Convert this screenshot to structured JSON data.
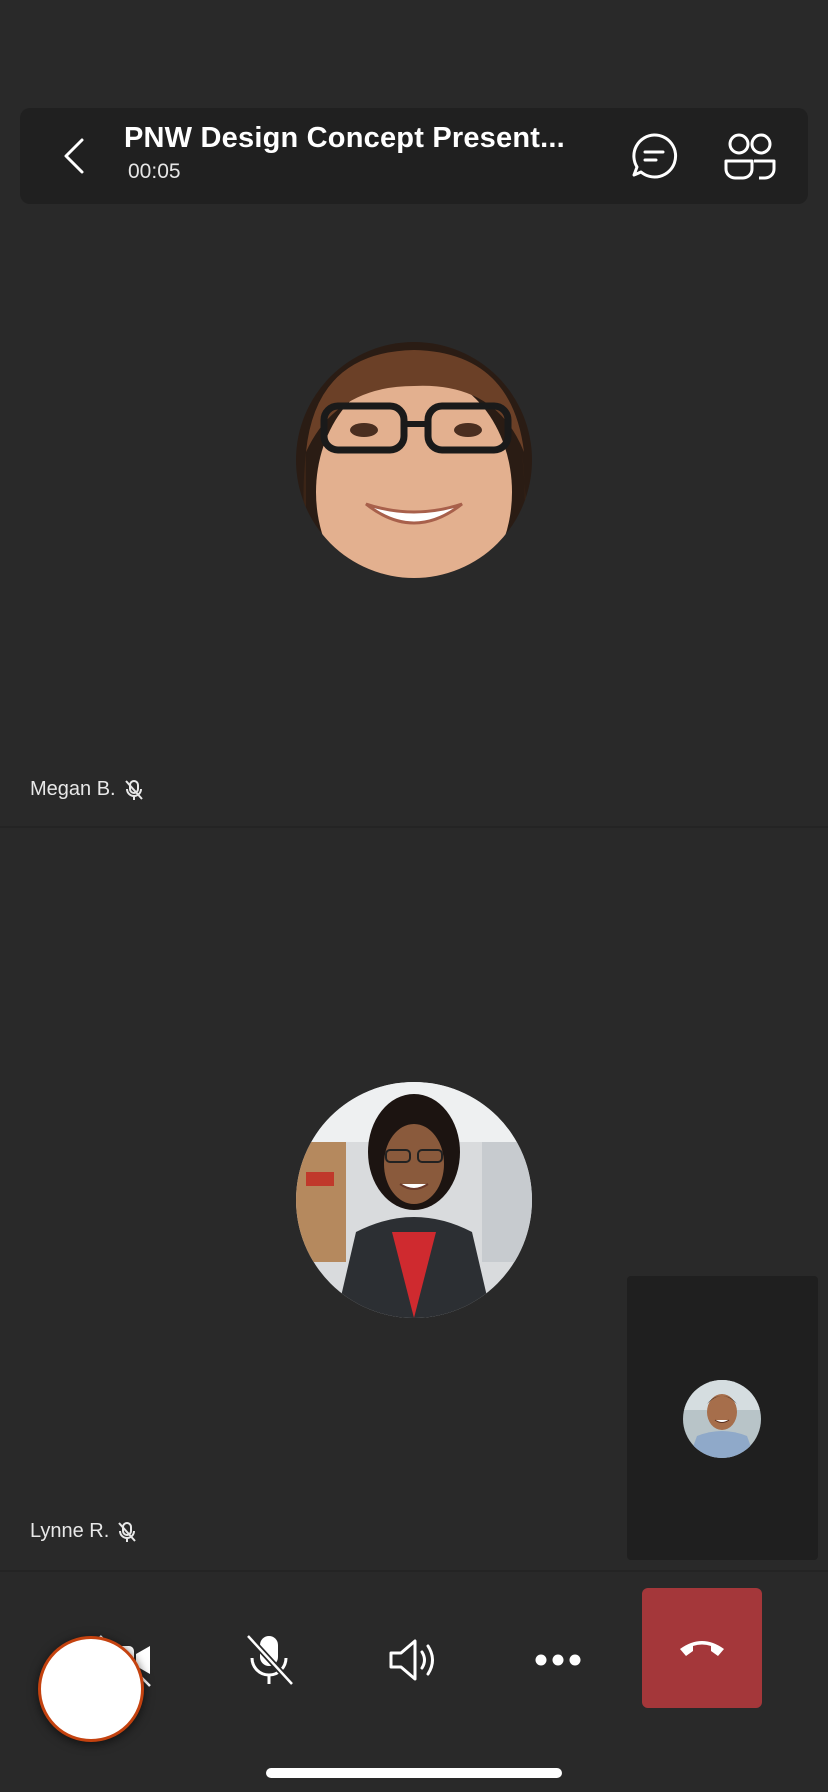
{
  "header": {
    "title": "PNW Design Concept Present...",
    "timer": "00:05"
  },
  "participants": [
    {
      "name": "Megan B.",
      "muted": true
    },
    {
      "name": "Lynne R.",
      "muted": true
    }
  ],
  "self_view": {
    "visible": true
  },
  "controls": {
    "video": "video-off",
    "mic": "mic-off",
    "speaker": "speaker-on",
    "more": "more",
    "hangup": "end-call"
  },
  "colors": {
    "background": "#292929",
    "header_bg": "#202020",
    "hangup": "#a4373a",
    "record_ring": "#c4420f"
  }
}
